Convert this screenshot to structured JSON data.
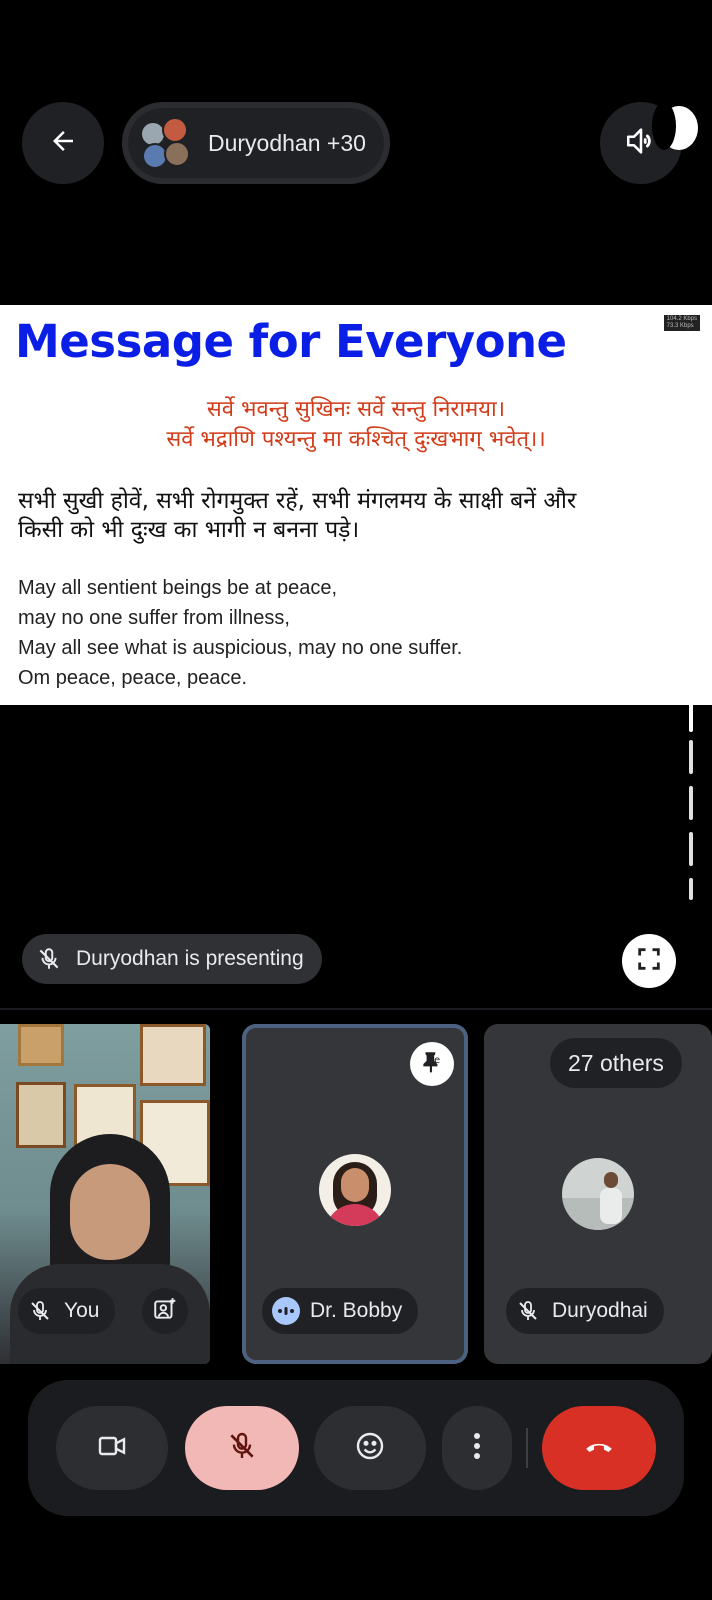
{
  "header": {
    "call_title": "Duryodhan +30",
    "back_icon": "arrow-left-icon",
    "speaker_icon": "speaker-icon"
  },
  "slide": {
    "title": "Message for Everyone",
    "kbps": [
      "104.2 Kbps",
      "73.3 Kbps"
    ],
    "sanskrit": [
      "सर्वे भवन्तु सुखिनः सर्वे सन्तु निरामया।",
      "सर्वे भद्राणि पश्यन्तु मा कश्चित् दुःखभाग् भवेत्।।"
    ],
    "hindi": [
      "सभी सुखी होवें, सभी रोगमुक्त रहें, सभी मंगलमय के साक्षी बनें और",
      "किसी को भी दुःख का भागी न बनना पड़े।"
    ],
    "english": [
      "May all sentient beings be at peace,",
      "may no one suffer from illness,",
      "May all see what is auspicious, may no one suffer.",
      "Om peace, peace, peace."
    ]
  },
  "presenting": {
    "label": "Duryodhan is presenting"
  },
  "tiles": {
    "you": {
      "label": "You"
    },
    "bobby": {
      "label": "Dr. Bobby"
    },
    "others": {
      "count_label": "27 others",
      "label": "Duryodhai"
    }
  },
  "colors": {
    "end_call": "#d93025",
    "mic_off_bg": "#f2b8b5",
    "title_blue": "#0a1ee6",
    "sanskrit_red": "#d23c1a"
  }
}
